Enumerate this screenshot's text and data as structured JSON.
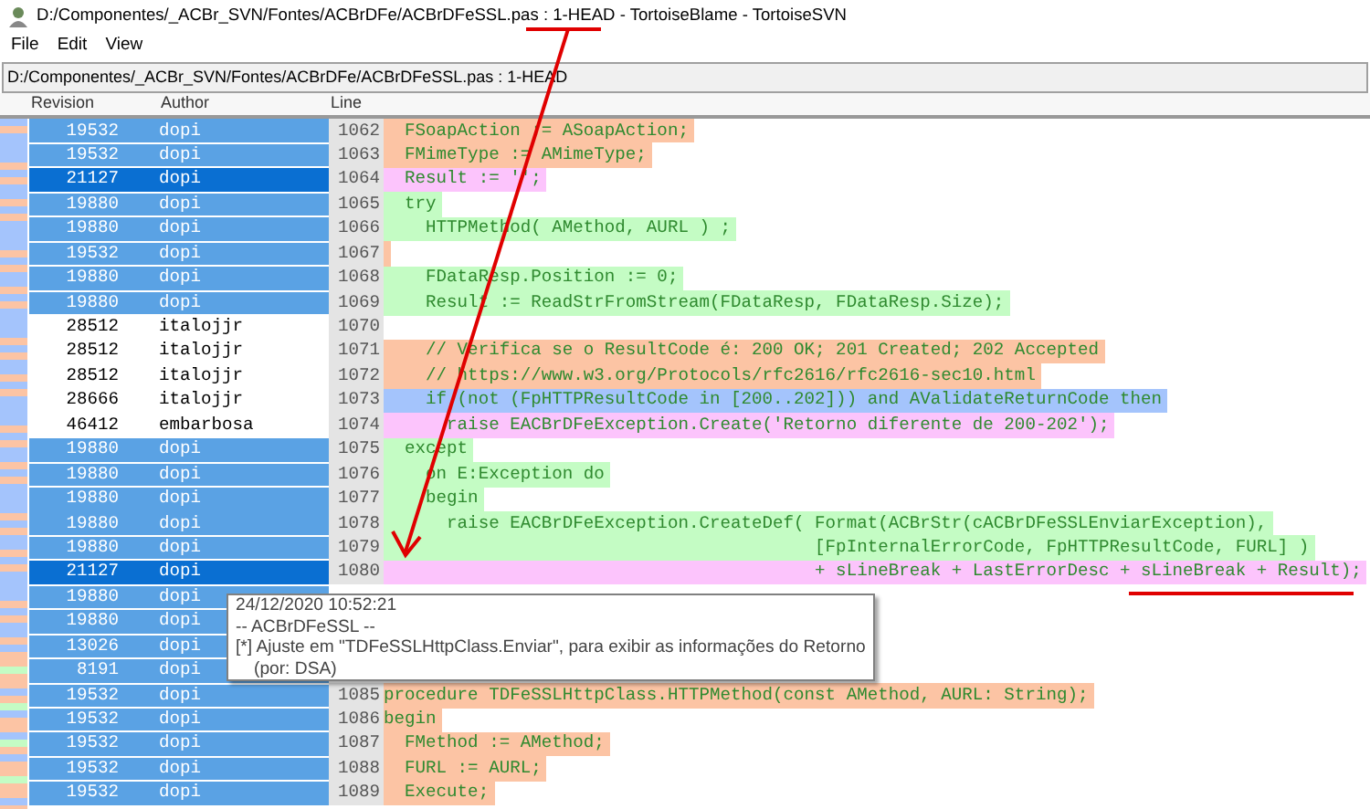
{
  "window": {
    "title_path": "D:/Componentes/_ACBr_SVN/Fontes/ACBrDFe/ACBrDFeSSL.pas :",
    "title_rev": "1-HEAD",
    "title_rest": "- TortoiseBlame - TortoiseSVN"
  },
  "menu": [
    "File",
    "Edit",
    "View"
  ],
  "path_bar": "D:/Componentes/_ACBr_SVN/Fontes/ACBrDFe/ACBrDFeSSL.pas : 1-HEAD",
  "columns": [
    "Revision",
    "Author",
    "Line"
  ],
  "rows": [
    {
      "revision": "19532",
      "author": "dopi",
      "highlighted": true,
      "selected": false,
      "line": "1062",
      "code": "  FSoapAction := ASoapAction;",
      "color": "#fcc4a4"
    },
    {
      "revision": "19532",
      "author": "dopi",
      "highlighted": true,
      "selected": false,
      "line": "1063",
      "code": "  FMimeType := AMimeType;",
      "color": "#fcc4a4"
    },
    {
      "revision": "21127",
      "author": "dopi",
      "highlighted": true,
      "selected": true,
      "line": "1064",
      "code": "  Result := '';",
      "color": "#fcc4fc"
    },
    {
      "revision": "19880",
      "author": "dopi",
      "highlighted": true,
      "selected": false,
      "line": "1065",
      "code": "  try",
      "color": "#c4fcc4"
    },
    {
      "revision": "19880",
      "author": "dopi",
      "highlighted": true,
      "selected": false,
      "line": "1066",
      "code": "    HTTPMethod( AMethod, AURL ) ;",
      "color": "#c4fcc4"
    },
    {
      "revision": "19532",
      "author": "dopi",
      "highlighted": true,
      "selected": false,
      "line": "1067",
      "color": "#fcc4a4"
    },
    {
      "revision": "19880",
      "author": "dopi",
      "highlighted": true,
      "selected": false,
      "line": "1068",
      "code": "    FDataResp.Position := 0;",
      "color": "#c4fcc4"
    },
    {
      "revision": "19880",
      "author": "dopi",
      "highlighted": true,
      "selected": false,
      "line": "1069",
      "code": "    Result := ReadStrFromStream(FDataResp, FDataResp.Size);",
      "color": "#c4fcc4"
    },
    {
      "revision": "28512",
      "author": "italojjr",
      "highlighted": false,
      "selected": false,
      "line": "1070",
      "color": "#ffffff"
    },
    {
      "revision": "28512",
      "author": "italojjr",
      "highlighted": false,
      "selected": false,
      "line": "1071",
      "code": "    // Verifica se o ResultCode é: 200 OK; 201 Created; 202 Accepted",
      "color": "#fcc4a4"
    },
    {
      "revision": "28512",
      "author": "italojjr",
      "highlighted": false,
      "selected": false,
      "line": "1072",
      "code": "    // https://www.w3.org/Protocols/rfc2616/rfc2616-sec10.html",
      "color": "#fcc4a4"
    },
    {
      "revision": "28666",
      "author": "italojjr",
      "highlighted": false,
      "selected": false,
      "line": "1073",
      "code": "    if (not (FpHTTPResultCode in [200..202])) and AValidateReturnCode then",
      "color": "#a4c4fc"
    },
    {
      "revision": "46412",
      "author": "embarbosa",
      "highlighted": false,
      "selected": false,
      "line": "1074",
      "code": "      raise EACBrDFeException.Create('Retorno diferente de 200-202');",
      "color": "#fcc4fc"
    },
    {
      "revision": "19880",
      "author": "dopi",
      "highlighted": true,
      "selected": false,
      "line": "1075",
      "code": "  except",
      "color": "#c4fcc4"
    },
    {
      "revision": "19880",
      "author": "dopi",
      "highlighted": true,
      "selected": false,
      "line": "1076",
      "code": "    on E:Exception do",
      "color": "#c4fcc4"
    },
    {
      "revision": "19880",
      "author": "dopi",
      "highlighted": true,
      "selected": false,
      "line": "1077",
      "code": "    begin",
      "color": "#c4fcc4"
    },
    {
      "revision": "19880",
      "author": "dopi",
      "highlighted": true,
      "selected": false,
      "line": "1078",
      "code": "      raise EACBrDFeException.CreateDef( Format(ACBrStr(cACBrDFeSSLEnviarException),",
      "color": "#c4fcc4"
    },
    {
      "revision": "19880",
      "author": "dopi",
      "highlighted": true,
      "selected": false,
      "line": "1079",
      "code": "                                         [FpInternalErrorCode, FpHTTPResultCode, FURL] )",
      "color": "#c4fcc4"
    },
    {
      "revision": "21127",
      "author": "dopi",
      "highlighted": true,
      "selected": true,
      "line": "1080",
      "code": "                                         + sLineBreak + LastErrorDesc + sLineBreak + Result);",
      "color": "#fcc4fc"
    },
    {
      "revision": "19880",
      "author": "dopi",
      "highlighted": true,
      "selected": false
    },
    {
      "revision": "19880",
      "author": "dopi",
      "highlighted": true,
      "selected": false
    },
    {
      "revision": "13026",
      "author": "dopi",
      "highlighted": true,
      "selected": false
    },
    {
      "revision": "8191",
      "author": "dopi",
      "highlighted": true,
      "selected": false
    },
    {
      "revision": "19532",
      "author": "dopi",
      "highlighted": true,
      "selected": false,
      "line": "1085",
      "code": "procedure TDFeSSLHttpClass.HTTPMethod(const AMethod, AURL: String);",
      "color": "#fcc4a4"
    },
    {
      "revision": "19532",
      "author": "dopi",
      "highlighted": true,
      "selected": false,
      "line": "1086",
      "code": "begin",
      "color": "#fcc4a4"
    },
    {
      "revision": "19532",
      "author": "dopi",
      "highlighted": true,
      "selected": false,
      "line": "1087",
      "code": "  FMethod := AMethod;",
      "color": "#fcc4a4"
    },
    {
      "revision": "19532",
      "author": "dopi",
      "highlighted": true,
      "selected": false,
      "line": "1088",
      "code": "  FURL := AURL;",
      "color": "#fcc4a4"
    },
    {
      "revision": "19532",
      "author": "dopi",
      "highlighted": true,
      "selected": false,
      "line": "1089",
      "code": "  Execute;",
      "color": "#fcc4a4"
    }
  ],
  "tooltip": {
    "date": "24/12/2020 10:52:21",
    "module": "-- ACBrDFeSSL --",
    "message": "[*] Ajuste em \"TDFeSSLHttpClass.Enviar\", para exibir as informações do Retorno",
    "author": "(por: DSA)"
  }
}
